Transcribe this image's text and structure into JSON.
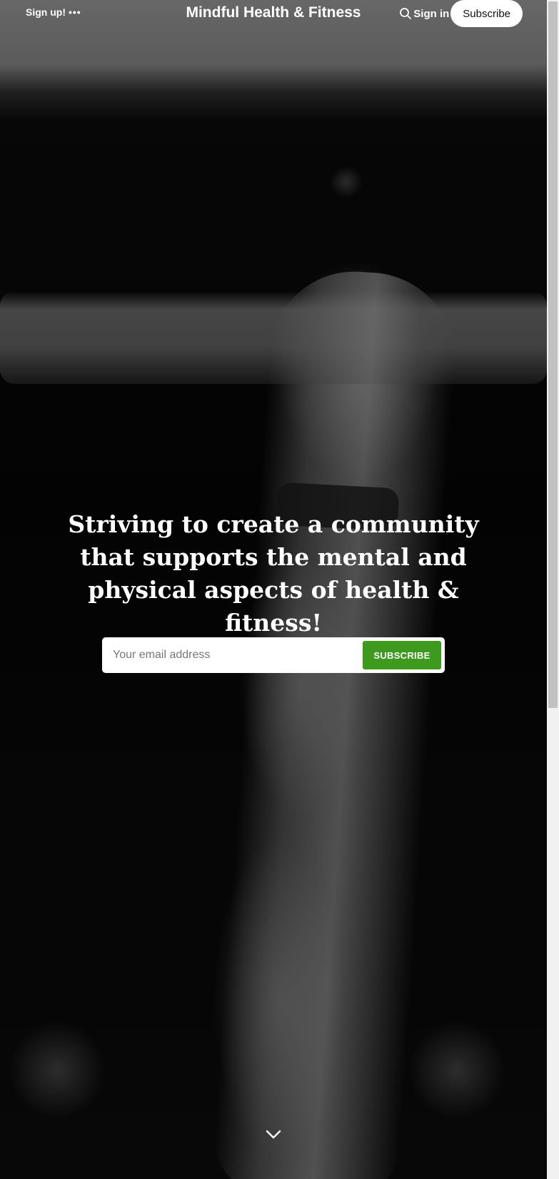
{
  "header": {
    "signup_label": "Sign up!",
    "more_icon": "more-dots-icon",
    "site_title": "Mindful Health & Fitness",
    "search_icon": "search-icon",
    "signin_label": "Sign in",
    "subscribe_label": "Subscribe"
  },
  "hero": {
    "headline": "Striving to create a community that supports the mental and physical aspects of health & fitness!",
    "email_placeholder": "Your email address",
    "subscribe_button": "SUBSCRIBE",
    "scroll_icon": "chevron-down-icon"
  },
  "colors": {
    "accent": "#3e9a1f",
    "text": "#ffffff"
  }
}
